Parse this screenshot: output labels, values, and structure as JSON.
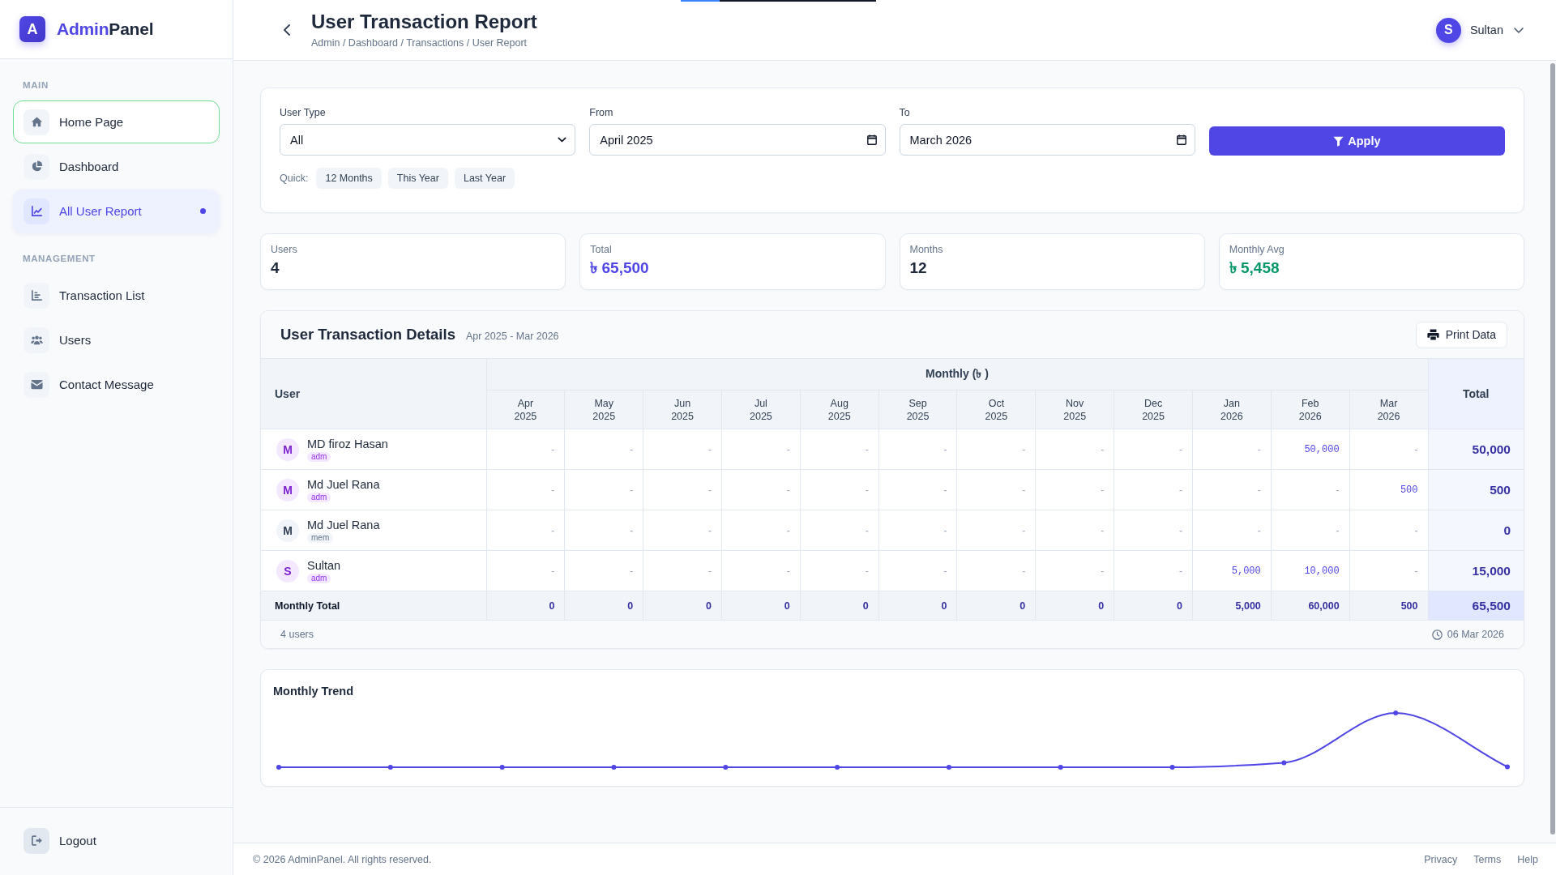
{
  "loading_bar": {
    "level": 0.2
  },
  "sidebar": {
    "logo_letter": "A",
    "brand_accent": "Admin",
    "brand_rest": "Panel",
    "sections": [
      {
        "title": "MAIN",
        "items": [
          {
            "label": "Home Page",
            "kind": "home",
            "selected": false,
            "focused": true
          },
          {
            "label": "Dashboard",
            "kind": "pie",
            "selected": false,
            "focused": false
          },
          {
            "label": "All User Report",
            "kind": "line",
            "selected": true,
            "focused": false
          }
        ]
      },
      {
        "title": "MANAGEMENT",
        "items": [
          {
            "label": "Transaction List",
            "kind": "bars",
            "selected": false,
            "focused": false
          },
          {
            "label": "Users",
            "kind": "users",
            "selected": false,
            "focused": false
          },
          {
            "label": "Contact Message",
            "kind": "envelope",
            "selected": false,
            "focused": false
          }
        ]
      }
    ],
    "logout": "Logout"
  },
  "header": {
    "title": "User Transaction Report",
    "breadcrumb": "Admin / Dashboard / Transactions / User Report",
    "user": {
      "initial": "S",
      "name": "Sultan"
    }
  },
  "filters": {
    "fields": [
      {
        "label": "User Type",
        "kind": "select",
        "value": "All"
      },
      {
        "label": "From",
        "kind": "date",
        "value": "April 2025"
      },
      {
        "label": "To",
        "kind": "date",
        "value": "March 2026"
      }
    ],
    "apply_button": "Apply",
    "quick_label": "Quick:",
    "quick_options": [
      "12 Months",
      "This Year",
      "Last Year"
    ]
  },
  "stats": [
    {
      "label": "Users",
      "value": "4",
      "color": "#1e293b"
    },
    {
      "label": "Total",
      "value": "৳ 65,500",
      "color": "#4f46e5"
    },
    {
      "label": "Months",
      "value": "12",
      "color": "#1e293b"
    },
    {
      "label": "Monthly Avg",
      "value": "৳ 5,458",
      "color": "#059669"
    }
  ],
  "table": {
    "title": "User Transaction Details",
    "period": "Apr 2025 - Mar 2026",
    "print_button": "Print Data",
    "columns": {
      "user": "User",
      "monthly": "Monthly (৳ )",
      "total": "Total",
      "months": [
        {
          "month": "Apr",
          "year": "2025"
        },
        {
          "month": "May",
          "year": "2025"
        },
        {
          "month": "Jun",
          "year": "2025"
        },
        {
          "month": "Jul",
          "year": "2025"
        },
        {
          "month": "Aug",
          "year": "2025"
        },
        {
          "month": "Sep",
          "year": "2025"
        },
        {
          "month": "Oct",
          "year": "2025"
        },
        {
          "month": "Nov",
          "year": "2025"
        },
        {
          "month": "Dec",
          "year": "2025"
        },
        {
          "month": "Jan",
          "year": "2026"
        },
        {
          "month": "Feb",
          "year": "2026"
        },
        {
          "month": "Mar",
          "year": "2026"
        }
      ]
    },
    "rows": [
      {
        "initial": "M",
        "name": "MD firoz Hasan",
        "role": "adm",
        "kind": "admin",
        "cells": [
          {
            "text": "-",
            "kind": "empty"
          },
          {
            "text": "-",
            "kind": "empty"
          },
          {
            "text": "-",
            "kind": "empty"
          },
          {
            "text": "-",
            "kind": "empty"
          },
          {
            "text": "-",
            "kind": "empty"
          },
          {
            "text": "-",
            "kind": "empty"
          },
          {
            "text": "-",
            "kind": "empty"
          },
          {
            "text": "-",
            "kind": "empty"
          },
          {
            "text": "-",
            "kind": "empty"
          },
          {
            "text": "-",
            "kind": "empty"
          },
          {
            "text": "50,000",
            "kind": "amount"
          },
          {
            "text": "-",
            "kind": "empty"
          }
        ],
        "total": "50,000"
      },
      {
        "initial": "M",
        "name": "Md Juel Rana",
        "role": "adm",
        "kind": "admin",
        "cells": [
          {
            "text": "-",
            "kind": "empty"
          },
          {
            "text": "-",
            "kind": "empty"
          },
          {
            "text": "-",
            "kind": "empty"
          },
          {
            "text": "-",
            "kind": "empty"
          },
          {
            "text": "-",
            "kind": "empty"
          },
          {
            "text": "-",
            "kind": "empty"
          },
          {
            "text": "-",
            "kind": "empty"
          },
          {
            "text": "-",
            "kind": "empty"
          },
          {
            "text": "-",
            "kind": "empty"
          },
          {
            "text": "-",
            "kind": "empty"
          },
          {
            "text": "-",
            "kind": "empty"
          },
          {
            "text": "500",
            "kind": "amount"
          }
        ],
        "total": "500"
      },
      {
        "initial": "M",
        "name": "Md Juel Rana",
        "role": "mem",
        "kind": "member",
        "cells": [
          {
            "text": "-",
            "kind": "empty"
          },
          {
            "text": "-",
            "kind": "empty"
          },
          {
            "text": "-",
            "kind": "empty"
          },
          {
            "text": "-",
            "kind": "empty"
          },
          {
            "text": "-",
            "kind": "empty"
          },
          {
            "text": "-",
            "kind": "empty"
          },
          {
            "text": "-",
            "kind": "empty"
          },
          {
            "text": "-",
            "kind": "empty"
          },
          {
            "text": "-",
            "kind": "empty"
          },
          {
            "text": "-",
            "kind": "empty"
          },
          {
            "text": "-",
            "kind": "empty"
          },
          {
            "text": "-",
            "kind": "empty"
          }
        ],
        "total": "0"
      },
      {
        "initial": "S",
        "name": "Sultan",
        "role": "adm",
        "kind": "admin",
        "cells": [
          {
            "text": "-",
            "kind": "empty"
          },
          {
            "text": "-",
            "kind": "empty"
          },
          {
            "text": "-",
            "kind": "empty"
          },
          {
            "text": "-",
            "kind": "empty"
          },
          {
            "text": "-",
            "kind": "empty"
          },
          {
            "text": "-",
            "kind": "empty"
          },
          {
            "text": "-",
            "kind": "empty"
          },
          {
            "text": "-",
            "kind": "empty"
          },
          {
            "text": "-",
            "kind": "empty"
          },
          {
            "text": "5,000",
            "kind": "amount"
          },
          {
            "text": "10,000",
            "kind": "amount"
          },
          {
            "text": "-",
            "kind": "empty"
          }
        ],
        "total": "15,000"
      }
    ],
    "totals": {
      "label": "Monthly Total",
      "cells": [
        "0",
        "0",
        "0",
        "0",
        "0",
        "0",
        "0",
        "0",
        "0",
        "5,000",
        "60,000",
        "500"
      ],
      "total": "65,500"
    },
    "footer": {
      "count": "4 users",
      "date": "06 Mar 2026"
    }
  },
  "chart": {
    "title": "Monthly Trend"
  },
  "footer": {
    "copyright": "© 2026 AdminPanel. All rights reserved.",
    "links": [
      "Privacy",
      "Terms",
      "Help"
    ]
  }
}
